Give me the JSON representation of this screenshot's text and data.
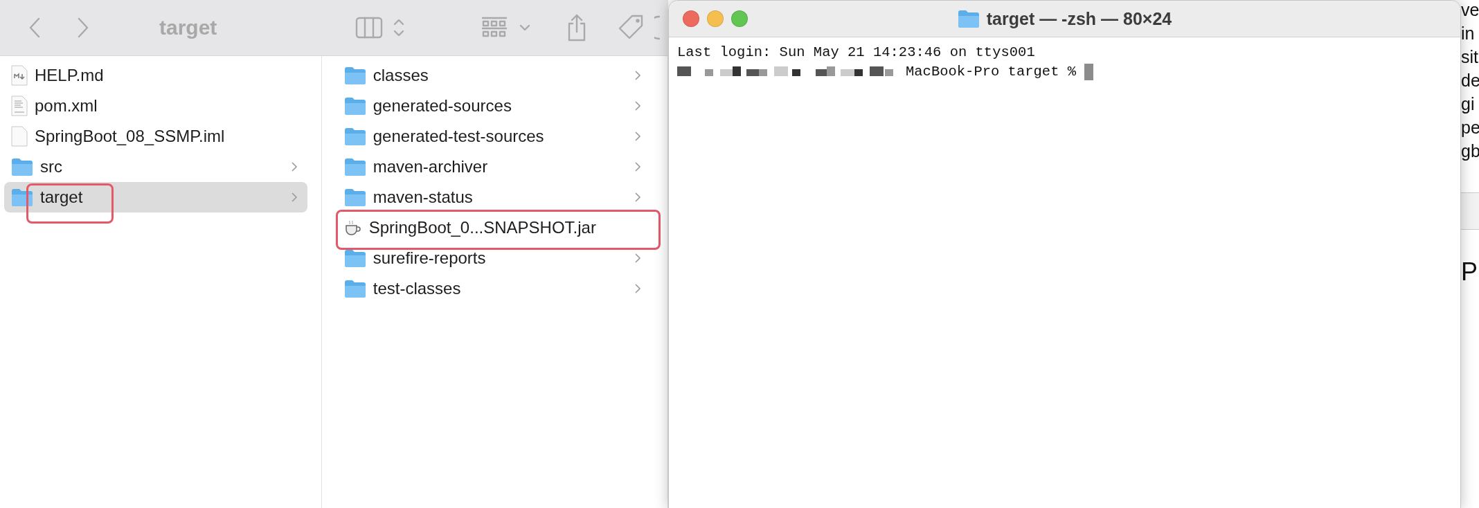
{
  "finder": {
    "toolbar": {
      "title": "target"
    },
    "columns": [
      {
        "items": [
          {
            "name": "HELP.md",
            "kind": "markdown",
            "has_children": false,
            "selected": false,
            "highlighted": false
          },
          {
            "name": "pom.xml",
            "kind": "xml",
            "has_children": false,
            "selected": false,
            "highlighted": false
          },
          {
            "name": "SpringBoot_08_SSMP.iml",
            "kind": "file",
            "has_children": false,
            "selected": false,
            "highlighted": false
          },
          {
            "name": "src",
            "kind": "folder",
            "has_children": true,
            "selected": false,
            "highlighted": false
          },
          {
            "name": "target",
            "kind": "folder",
            "has_children": true,
            "selected": true,
            "highlighted": true
          }
        ]
      },
      {
        "items": [
          {
            "name": "classes",
            "kind": "folder",
            "has_children": true,
            "selected": false,
            "highlighted": false
          },
          {
            "name": "generated-sources",
            "kind": "folder",
            "has_children": true,
            "selected": false,
            "highlighted": false
          },
          {
            "name": "generated-test-sources",
            "kind": "folder",
            "has_children": true,
            "selected": false,
            "highlighted": false
          },
          {
            "name": "maven-archiver",
            "kind": "folder",
            "has_children": true,
            "selected": false,
            "highlighted": false
          },
          {
            "name": "maven-status",
            "kind": "folder",
            "has_children": true,
            "selected": false,
            "highlighted": false
          },
          {
            "name": "SpringBoot_0...SNAPSHOT.jar",
            "kind": "jar",
            "has_children": false,
            "selected": false,
            "highlighted": true
          },
          {
            "name": "surefire-reports",
            "kind": "folder",
            "has_children": true,
            "selected": false,
            "highlighted": false
          },
          {
            "name": "test-classes",
            "kind": "folder",
            "has_children": true,
            "selected": false,
            "highlighted": false
          }
        ]
      }
    ]
  },
  "terminal": {
    "title": "target — -zsh — 80×24",
    "last_login": "Last login: Sun May 21 14:23:46 on ttys001",
    "prompt": "MacBook-Pro target %"
  },
  "background_fragments": [
    "ve",
    "in",
    "sit",
    "de",
    "gi",
    "pe",
    "gb",
    "P"
  ]
}
